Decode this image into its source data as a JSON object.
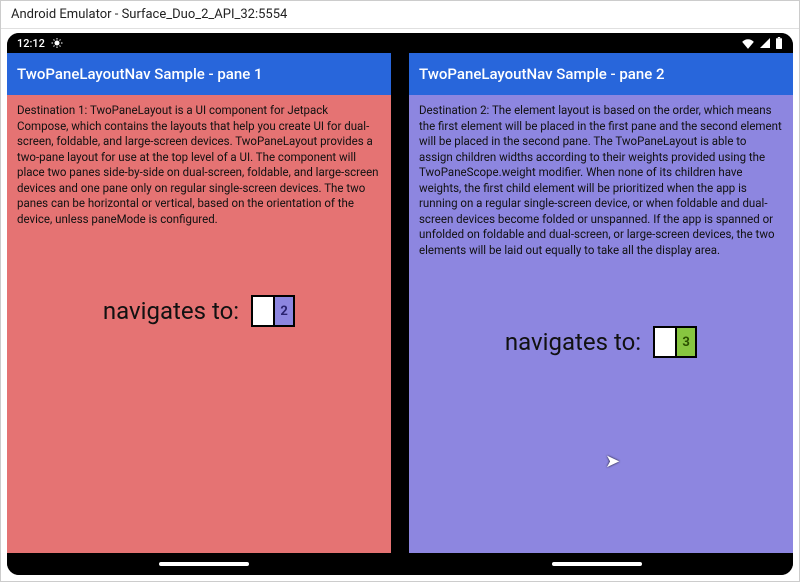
{
  "window": {
    "title": "Android Emulator - Surface_Duo_2_API_32:5554"
  },
  "statusbar": {
    "time": "12:12"
  },
  "pane1": {
    "appbar": "TwoPaneLayoutNav Sample - pane 1",
    "desc": "Destination 1: TwoPaneLayout is a UI component for Jetpack Compose, which contains the layouts that help you create UI for dual-screen, foldable, and large-screen devices. TwoPaneLayout provides a two-pane layout for use at the top level of a UI. The component will place two panes side-by-side on dual-screen, foldable, and large-screen devices and one pane only on regular single-screen devices. The two panes can be horizontal or vertical, based on the orientation of the device, unless paneMode is configured.",
    "navlabel": "navigates to:",
    "target": "2"
  },
  "pane2": {
    "appbar": "TwoPaneLayoutNav Sample - pane 2",
    "desc": "Destination 2: The element layout is based on the order, which means the first element will be placed in the first pane and the second element will be placed in the second pane. The TwoPaneLayout is able to assign children widths according to their weights provided using the TwoPaneScope.weight modifier. When none of its children have weights, the first child element will be prioritized when the app is running on a regular single-screen device, or when foldable and dual-screen devices become folded or unspanned. If the app is spanned or unfolded on foldable and dual-screen, or large-screen devices, the two elements will be laid out equally to take all the display area.",
    "navlabel": "navigates to:",
    "target": "3"
  }
}
